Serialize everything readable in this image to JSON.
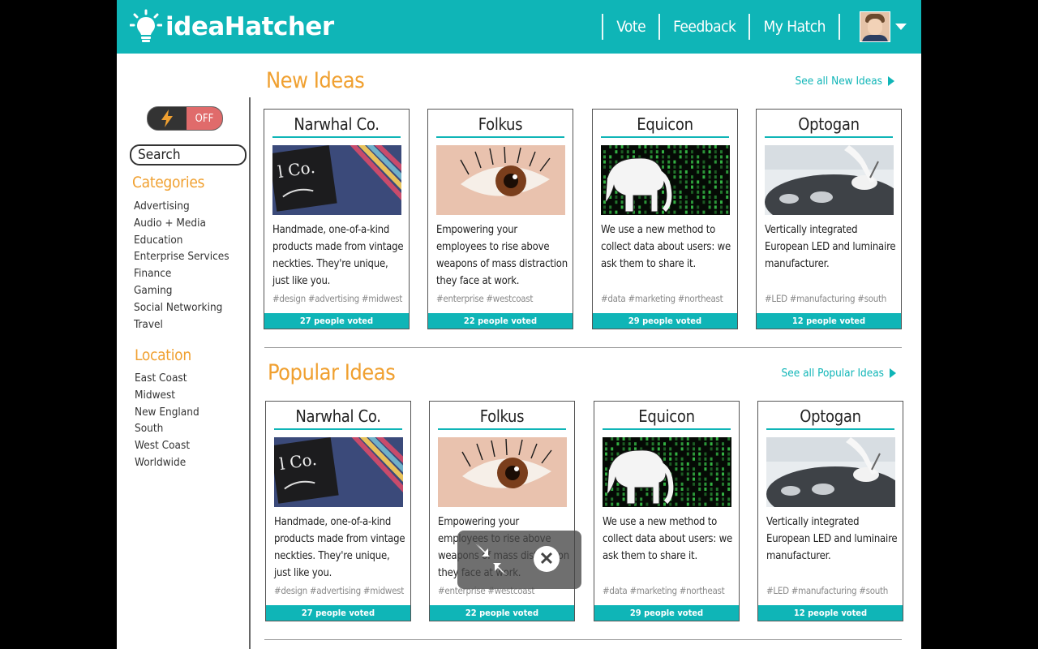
{
  "brand": {
    "name": "ideaHatcher",
    "color": "#0fb5b7",
    "accent": "#f0a030"
  },
  "nav": {
    "items": [
      "Vote",
      "Feedback",
      "My Hatch"
    ],
    "avatar_icon": "user-avatar",
    "menu_icon": "caret-down-icon"
  },
  "sidebar": {
    "toggle": {
      "icon": "lightning-icon",
      "label": "OFF"
    },
    "search": {
      "value": "Search"
    },
    "categories": {
      "heading": "Categories",
      "items": [
        "Advertising",
        "Audio + Media",
        "Education",
        "Enterprise Services",
        "Finance",
        "Gaming",
        "Social Networking",
        "Travel"
      ]
    },
    "location": {
      "heading": "Location",
      "items": [
        "East Coast",
        "Midwest",
        "New England",
        "South",
        "West Coast",
        "Worldwide"
      ]
    }
  },
  "sections": [
    {
      "title": "New Ideas",
      "see_all": "See all New Ideas",
      "cards": [
        {
          "name": "Narwhal Co.",
          "image": "necktie-label",
          "desc": "Handmade, one-of-a-kind products made from vintage neckties. They're unique, just like you.",
          "tags": "#design #advertising #midwest",
          "votes": "27 people voted"
        },
        {
          "name": "Folkus",
          "image": "eye-closeup",
          "desc": "Empowering your employees to rise above weapons of mass distraction they face at work.",
          "tags": "#enterprise #westcoast",
          "votes": "22 people voted"
        },
        {
          "name": "Equicon",
          "image": "elephant-matrix",
          "desc": "We use a new method to collect data about users: we ask them to share it.",
          "tags": "#data #marketing #northeast",
          "votes": "29 people voted"
        },
        {
          "name": "Optogan",
          "image": "lab-wafer",
          "desc": "Vertically integrated European LED and luminaire manufacturer.",
          "tags": "#LED #manufacturing #south",
          "votes": "12 people voted"
        }
      ]
    },
    {
      "title": "Popular Ideas",
      "see_all": "See all Popular Ideas",
      "cards": [
        {
          "name": "Narwhal Co.",
          "image": "necktie-label",
          "desc": "Handmade, one-of-a-kind products made from vintage neckties. They're unique, just like you.",
          "tags": "#design #advertising #midwest",
          "votes": "27 people voted"
        },
        {
          "name": "Folkus",
          "image": "eye-closeup",
          "desc": "Empowering your employees to rise above weapons of mass distraction they face at work.",
          "tags": "#enterprise #westcoast",
          "votes": "22 people voted"
        },
        {
          "name": "Equicon",
          "image": "elephant-matrix",
          "desc": "We use a new method to collect data about users: we ask them to share it.",
          "tags": "#data #marketing #northeast",
          "votes": "29 people voted"
        },
        {
          "name": "Optogan",
          "image": "lab-wafer",
          "desc": "Vertically integrated European LED and luminaire manufacturer.",
          "tags": "#LED #manufacturing #south",
          "votes": "12 people voted"
        }
      ]
    }
  ],
  "overlay": {
    "shrink_icon": "exit-fullscreen-icon",
    "close_icon": "close-icon"
  }
}
